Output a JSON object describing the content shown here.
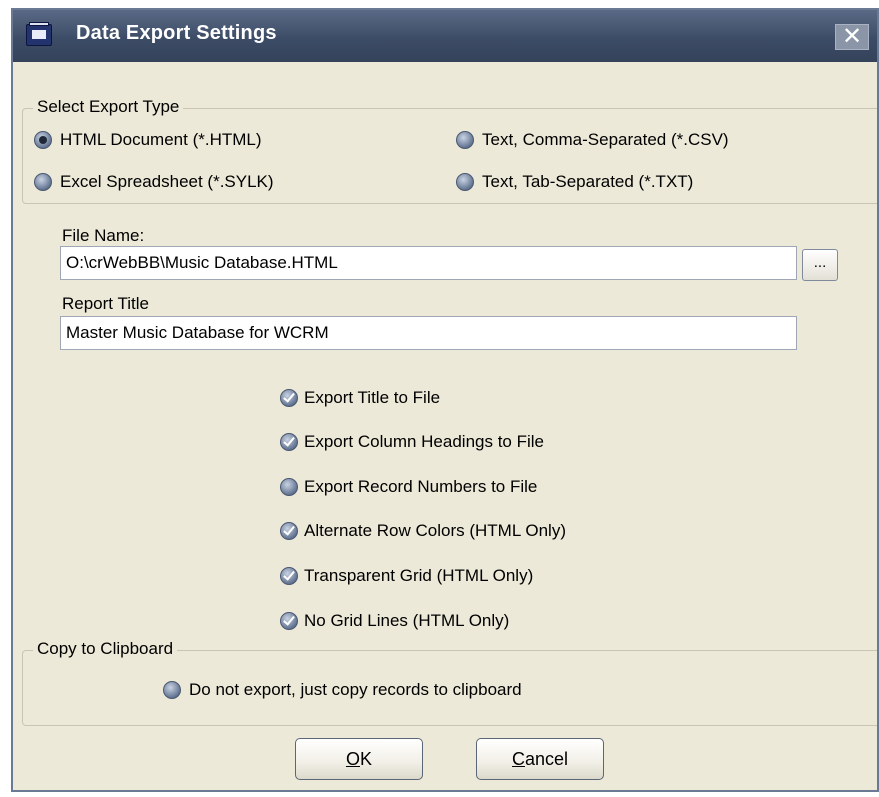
{
  "window": {
    "title": "Data Export Settings",
    "close_glyph": "✕",
    "app_icon": "app-window-icon"
  },
  "export_type": {
    "legend": "Select Export Type",
    "options": [
      {
        "label": "HTML Document (*.HTML)",
        "selected": true
      },
      {
        "label": "Text, Comma-Separated (*.CSV)",
        "selected": false
      },
      {
        "label": "Excel Spreadsheet (*.SYLK)",
        "selected": false
      },
      {
        "label": "Text, Tab-Separated (*.TXT)",
        "selected": false
      }
    ]
  },
  "file_name": {
    "label": "File Name:",
    "value": "O:\\crWebBB\\Music Database.HTML",
    "browse_label": "..."
  },
  "report_title": {
    "label": "Report Title",
    "value": "Master Music Database for WCRM"
  },
  "options": [
    {
      "label": "Export Title to File",
      "checked": true
    },
    {
      "label": "Export Column Headings to File",
      "checked": true
    },
    {
      "label": "Export Record Numbers to File",
      "checked": false
    },
    {
      "label": "Alternate Row Colors (HTML Only)",
      "checked": true
    },
    {
      "label": "Transparent Grid (HTML Only)",
      "checked": true
    },
    {
      "label": "No Grid Lines (HTML Only)",
      "checked": true
    }
  ],
  "clipboard": {
    "legend": "Copy to Clipboard",
    "option_label": "Do not export, just copy records to clipboard",
    "selected": false
  },
  "buttons": {
    "ok_mnemonic": "O",
    "ok_rest": "K",
    "cancel_mnemonic": "C",
    "cancel_rest": "ancel"
  },
  "colors": {
    "dialog_bg": "#ece9d8",
    "titlebar": "#3d4c66",
    "radio": "#5c6e8c"
  }
}
